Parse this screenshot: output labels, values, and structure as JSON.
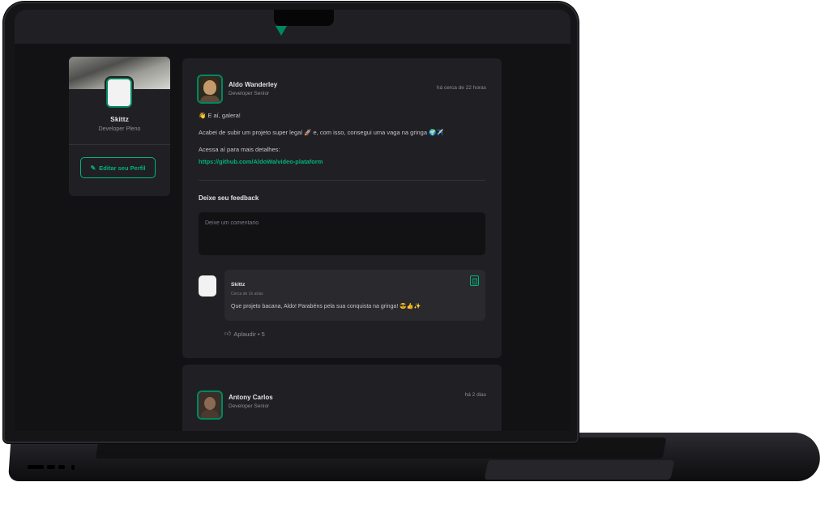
{
  "colors": {
    "accent": "#00b37e",
    "accent_dark": "#00875f",
    "background": "#121214",
    "card": "#202024"
  },
  "profile": {
    "name": "Skittz",
    "role": "Developer Pleno",
    "edit_button_label": "Editar seu Perfil",
    "edit_icon": "pencil-icon"
  },
  "post": {
    "author_name": "Aldo Wanderley",
    "author_role": "Developer Senior",
    "time": "há cerca de 22 horas",
    "paragraph_1": "👋 E aí, galera!",
    "paragraph_2": "Acabei de subir um projeto super legal 🚀 e, com isso, consegui uma vaga na gringa 🌍✈️",
    "paragraph_3": "Acessa aí para mais detalhes:",
    "link": "https://github.com/AldoWa/video-plataform",
    "feedback_title": "Deixe seu feedback",
    "comment_placeholder": "Deixe um comentario",
    "comment": {
      "author": "Skittz",
      "time": "Cerca de 1h atrás",
      "text": "Que projeto bacana, Aldo! Parabéns pela sua conquista na gringa! 😎👍✨",
      "delete_icon": "trash-icon",
      "applaud_label": "Aplaudir • 5",
      "applaud_icon": "thumbs-up-icon"
    }
  },
  "post_2": {
    "author_name": "Antony Carlos",
    "author_role": "Developer Senior",
    "time": "há 2 dias"
  }
}
